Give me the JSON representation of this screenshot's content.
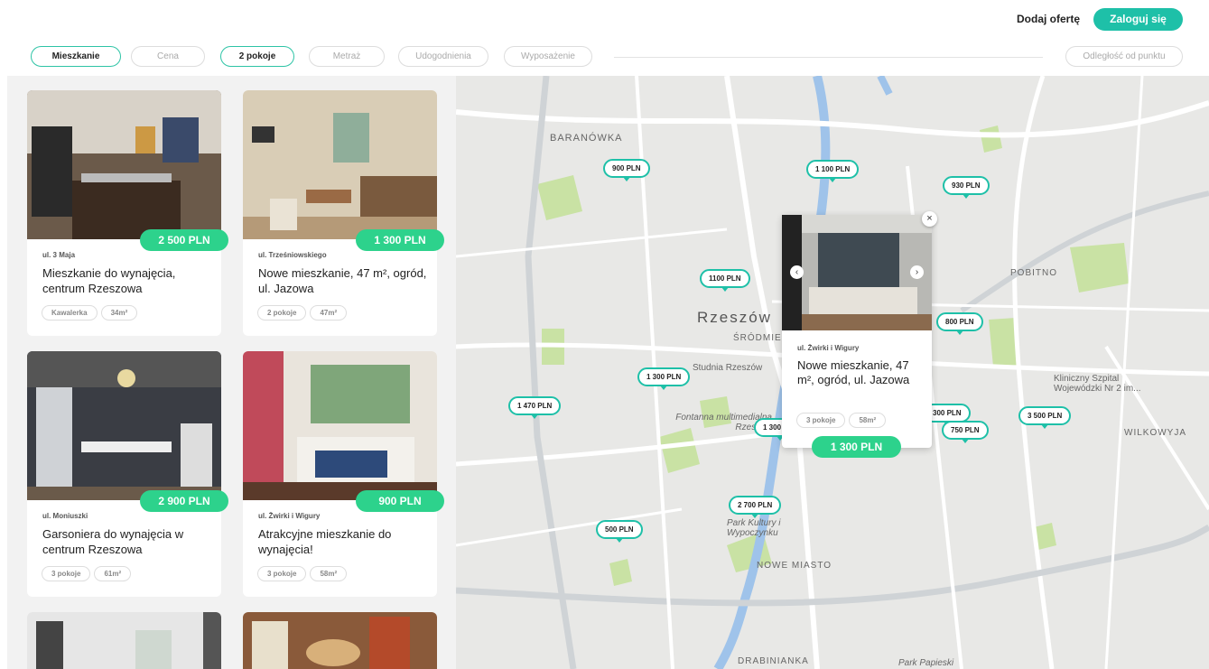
{
  "header": {
    "add_offer": "Dodaj ofertę",
    "login": "Zaloguj się"
  },
  "filters": {
    "items": [
      {
        "label": "Mieszkanie",
        "active": true
      },
      {
        "label": "Cena",
        "active": false
      },
      {
        "label": "2 pokoje",
        "active": true
      },
      {
        "label": "Metraż",
        "active": false
      },
      {
        "label": "Udogodnienia",
        "active": false
      },
      {
        "label": "Wyposażenie",
        "active": false
      }
    ],
    "distance": "Odległość od punktu"
  },
  "listings": [
    {
      "price": "2 500 PLN",
      "street": "ul. 3 Maja",
      "title": "Mieszkanie do wynajęcia, centrum Rzeszowa",
      "tags": [
        "Kawalerka",
        "34m²"
      ]
    },
    {
      "price": "1 300 PLN",
      "street": "ul. Trześniowskiego",
      "title": "Nowe mieszkanie, 47 m², ogród, ul. Jazowa",
      "tags": [
        "2 pokoje",
        "47m²"
      ]
    },
    {
      "price": "2 900 PLN",
      "street": "ul. Moniuszki",
      "title": "Garsoniera do wynajęcia w centrum Rzeszowa",
      "tags": [
        "3 pokoje",
        "61m²"
      ]
    },
    {
      "price": "900 PLN",
      "street": "ul. Żwirki i Wigury",
      "title": "Atrakcyjne mieszkanie do wynajęcia!",
      "tags": [
        "3 pokoje",
        "58m²"
      ]
    }
  ],
  "map": {
    "labels": [
      "BARANÓWKA",
      "Rzeszów",
      "ŚRÓDMIEŚCIE",
      "POBITNO",
      "WILKOWYJA",
      "NOWE MIASTO",
      "Park Kultury i Wypoczynku",
      "Fontanna multimedialna Rzeszów",
      "Studnia Rzeszów",
      "Kliniczny Szpital Wojewódzki Nr 2 im...",
      "DRABINIANKA",
      "Park Papieski"
    ],
    "pins": [
      "900 PLN",
      "1 100 PLN",
      "930 PLN",
      "1100 PLN",
      "800 PLN",
      "1 300 PLN",
      "1 470 PLN",
      "1 300 PLN",
      "300 PLN",
      "750 PLN",
      "3 500 PLN",
      "2 700 PLN",
      "500 PLN"
    ],
    "popup": {
      "street": "ul. Żwirki i Wigury",
      "title": "Nowe mieszkanie, 47 m², ogród, ul. Jazowa",
      "tags": [
        "3 pokoje",
        "58m²"
      ],
      "price": "1 300 PLN",
      "close": "×",
      "prev": "‹",
      "next": "›"
    }
  },
  "colors": {
    "accent": "#1ec0a8",
    "price_green": "#2dd28c"
  }
}
